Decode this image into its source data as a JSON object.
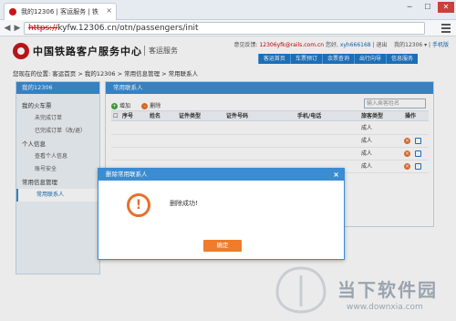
{
  "browser": {
    "tab_title": "我的12306 | 客运服务 | 铁",
    "url_scheme": "https://",
    "url_rest": "kyfw.12306.cn/otn/passengers/init"
  },
  "header": {
    "site_name": "中国铁路客户服务中心",
    "site_sub": "客运服务",
    "feedback": "意见反馈:",
    "email": "12306yfk@rails.com.cn",
    "greet": "您好,",
    "user": "xyh666168",
    "logout": "退出",
    "my12306": "我的12306",
    "mobile": "手机版",
    "nav": [
      "客运首页",
      "车票预订",
      "余票查询",
      "出行向导",
      "信息服务"
    ]
  },
  "breadcrumb": "您现在的位置: 客运首页 > 我的12306 > 常用信息管理 > 常用联系人",
  "sidebar": {
    "title": "我的12306",
    "sections": [
      {
        "label": "我的火车票",
        "items": [
          "未完成订单",
          "已完成订单（改/退）"
        ]
      },
      {
        "label": "个人信息",
        "items": [
          "查看个人信息",
          "账号安全"
        ]
      },
      {
        "label": "常用信息管理",
        "items": [
          "常用联系人"
        ]
      }
    ]
  },
  "content": {
    "title": "常用联系人",
    "add": "增加",
    "delete": "删除",
    "search_placeholder": "输入乘客姓名",
    "columns": [
      "序号",
      "姓名",
      "证件类型",
      "证件号码",
      "手机/电话",
      "旅客类型",
      "操作"
    ],
    "rows": [
      {
        "type": "成人"
      },
      {
        "type": "成人"
      },
      {
        "type": "成人"
      },
      {
        "type": "成人"
      }
    ]
  },
  "dialog": {
    "title": "删除常用联系人",
    "message": "删除成功!",
    "ok": "确定"
  },
  "watermark": {
    "text": "当下软件园",
    "url": "www.downxia.com"
  }
}
